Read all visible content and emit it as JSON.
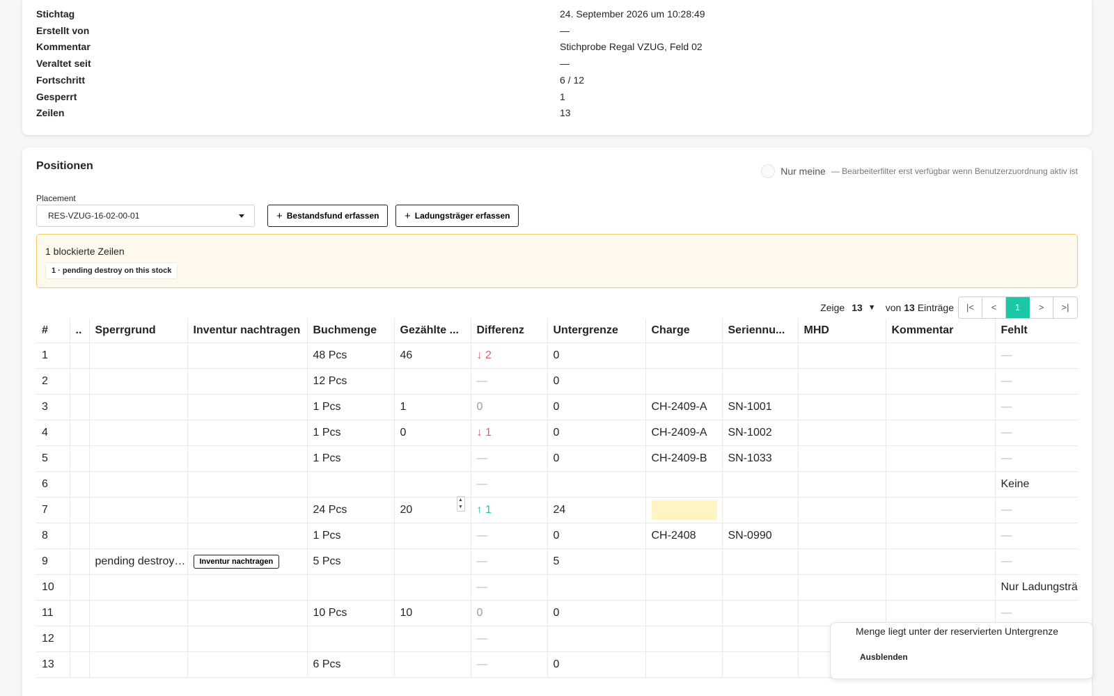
{
  "meta": [
    {
      "label": "Stichtag",
      "value": "24. September 2026 um 10:28:49"
    },
    {
      "label": "Erstellt von",
      "value": "—"
    },
    {
      "label": "Kommentar",
      "value": "Stichprobe Regal VZUG, Feld 02"
    },
    {
      "label": "Veraltet seit",
      "value": "—"
    },
    {
      "label": "Fortschritt",
      "value": "6 / 12"
    },
    {
      "label": "Gesperrt",
      "value": "1"
    },
    {
      "label": "Zeilen",
      "value": "13"
    }
  ],
  "positionen": {
    "title": "Positionen",
    "filter_label": "Nur meine",
    "filter_hint": "— Bearbeiterfilter erst verfügbar wenn Benutzerzuordnung aktiv ist",
    "placement_label": "Placement",
    "placement_value": "RES-VZUG-16-02-00-01",
    "btn_bestandsfund": "Bestandsfund erfassen",
    "btn_ladungstraeger": "Ladungsträger erfassen",
    "plus": "+"
  },
  "warning": {
    "title": "1 blockierte Zeilen",
    "chip": "1 · pending destroy on this stock"
  },
  "pager": {
    "zeige": "Zeige",
    "page_size": "13",
    "von": "von",
    "total": "13",
    "eintraege": "Einträge",
    "first": "|<",
    "prev": "<",
    "current": "1",
    "next": ">",
    "last": ">|"
  },
  "table": {
    "headers": [
      "#",
      "..",
      "Sperrgrund",
      "Inventur nachtragen",
      "Buchmenge",
      "Gezählte ...",
      "Differenz",
      "Untergrenze",
      "Charge",
      "Seriennu...",
      "MHD",
      "Kommentar",
      "Fehlt"
    ],
    "rows": [
      {
        "n": "1",
        "sperr": "",
        "inv": "",
        "buch": "48 Pcs",
        "gez": "46",
        "diff": "↓ 2",
        "diff_type": "down",
        "unter": "0",
        "charge": "",
        "serie": "",
        "mhd": "",
        "komm": "",
        "fehlt": "—"
      },
      {
        "n": "2",
        "sperr": "",
        "inv": "",
        "buch": "12 Pcs",
        "gez": "",
        "diff": "—",
        "diff_type": "dash",
        "unter": "0",
        "charge": "",
        "serie": "",
        "mhd": "",
        "komm": "",
        "fehlt": "—"
      },
      {
        "n": "3",
        "sperr": "",
        "inv": "",
        "buch": "1 Pcs",
        "gez": "1",
        "diff": "0",
        "diff_type": "zero",
        "unter": "0",
        "charge": "CH-2409-A",
        "serie": "SN-1001",
        "mhd": "",
        "komm": "",
        "fehlt": "—"
      },
      {
        "n": "4",
        "sperr": "",
        "inv": "",
        "buch": "1 Pcs",
        "gez": "0",
        "diff": "↓ 1",
        "diff_type": "down",
        "unter": "0",
        "charge": "CH-2409-A",
        "serie": "SN-1002",
        "mhd": "",
        "komm": "",
        "fehlt": "—"
      },
      {
        "n": "5",
        "sperr": "",
        "inv": "",
        "buch": "1 Pcs",
        "gez": "",
        "diff": "—",
        "diff_type": "dash",
        "unter": "0",
        "charge": "CH-2409-B",
        "serie": "SN-1033",
        "mhd": "",
        "komm": "",
        "fehlt": "—"
      },
      {
        "n": "6",
        "sperr": "",
        "inv": "",
        "buch": "",
        "gez": "",
        "diff": "—",
        "diff_type": "dash",
        "unter": "",
        "charge": "",
        "serie": "",
        "mhd": "",
        "komm": "",
        "fehlt": "Keine"
      },
      {
        "n": "7",
        "sperr": "",
        "inv": "",
        "buch": "24 Pcs",
        "gez": "20",
        "gez_stepper": true,
        "diff": "↑ 1",
        "diff_type": "up",
        "unter": "24",
        "charge": "",
        "charge_highlight": true,
        "serie": "",
        "mhd": "",
        "komm": "",
        "fehlt": "—"
      },
      {
        "n": "8",
        "sperr": "",
        "inv": "",
        "buch": "1 Pcs",
        "gez": "",
        "diff": "—",
        "diff_type": "dash",
        "unter": "0",
        "charge": "CH-2408",
        "serie": "SN-0990",
        "mhd": "",
        "komm": "",
        "fehlt": "—"
      },
      {
        "n": "9",
        "sperr": "pending destroy on this stock",
        "inv": "Inventur nachtragen",
        "buch": "5 Pcs",
        "gez": "",
        "diff": "—",
        "diff_type": "dash",
        "unter": "5",
        "charge": "",
        "serie": "",
        "mhd": "",
        "komm": "",
        "fehlt": "—"
      },
      {
        "n": "10",
        "sperr": "",
        "inv": "",
        "buch": "",
        "gez": "",
        "diff": "—",
        "diff_type": "dash",
        "unter": "",
        "charge": "",
        "serie": "",
        "mhd": "",
        "komm": "",
        "fehlt": "Nur Ladungsträger"
      },
      {
        "n": "11",
        "sperr": "",
        "inv": "",
        "buch": "10 Pcs",
        "gez": "10",
        "diff": "0",
        "diff_type": "zero",
        "unter": "0",
        "charge": "",
        "serie": "",
        "mhd": "",
        "komm": "",
        "fehlt": "—"
      },
      {
        "n": "12",
        "sperr": "",
        "inv": "",
        "buch": "",
        "gez": "",
        "diff": "—",
        "diff_type": "dash",
        "unter": "",
        "charge": "",
        "serie": "",
        "mhd": "",
        "komm": "",
        "fehlt": ""
      },
      {
        "n": "13",
        "sperr": "",
        "inv": "",
        "buch": "6 Pcs",
        "gez": "",
        "diff": "—",
        "diff_type": "dash",
        "unter": "0",
        "charge": "",
        "serie": "",
        "mhd": "",
        "komm": "",
        "fehlt": ""
      }
    ]
  },
  "popover": {
    "text": "Menge liegt unter der reservierten Untergrenze",
    "action": "Ausblenden"
  },
  "colors": {
    "accent": "#1cc7a6",
    "down": "#e45b6b",
    "warning_bg": "#fff8ec",
    "warning_border": "#f2c86a",
    "charge_highlight": "#fff4c2"
  }
}
